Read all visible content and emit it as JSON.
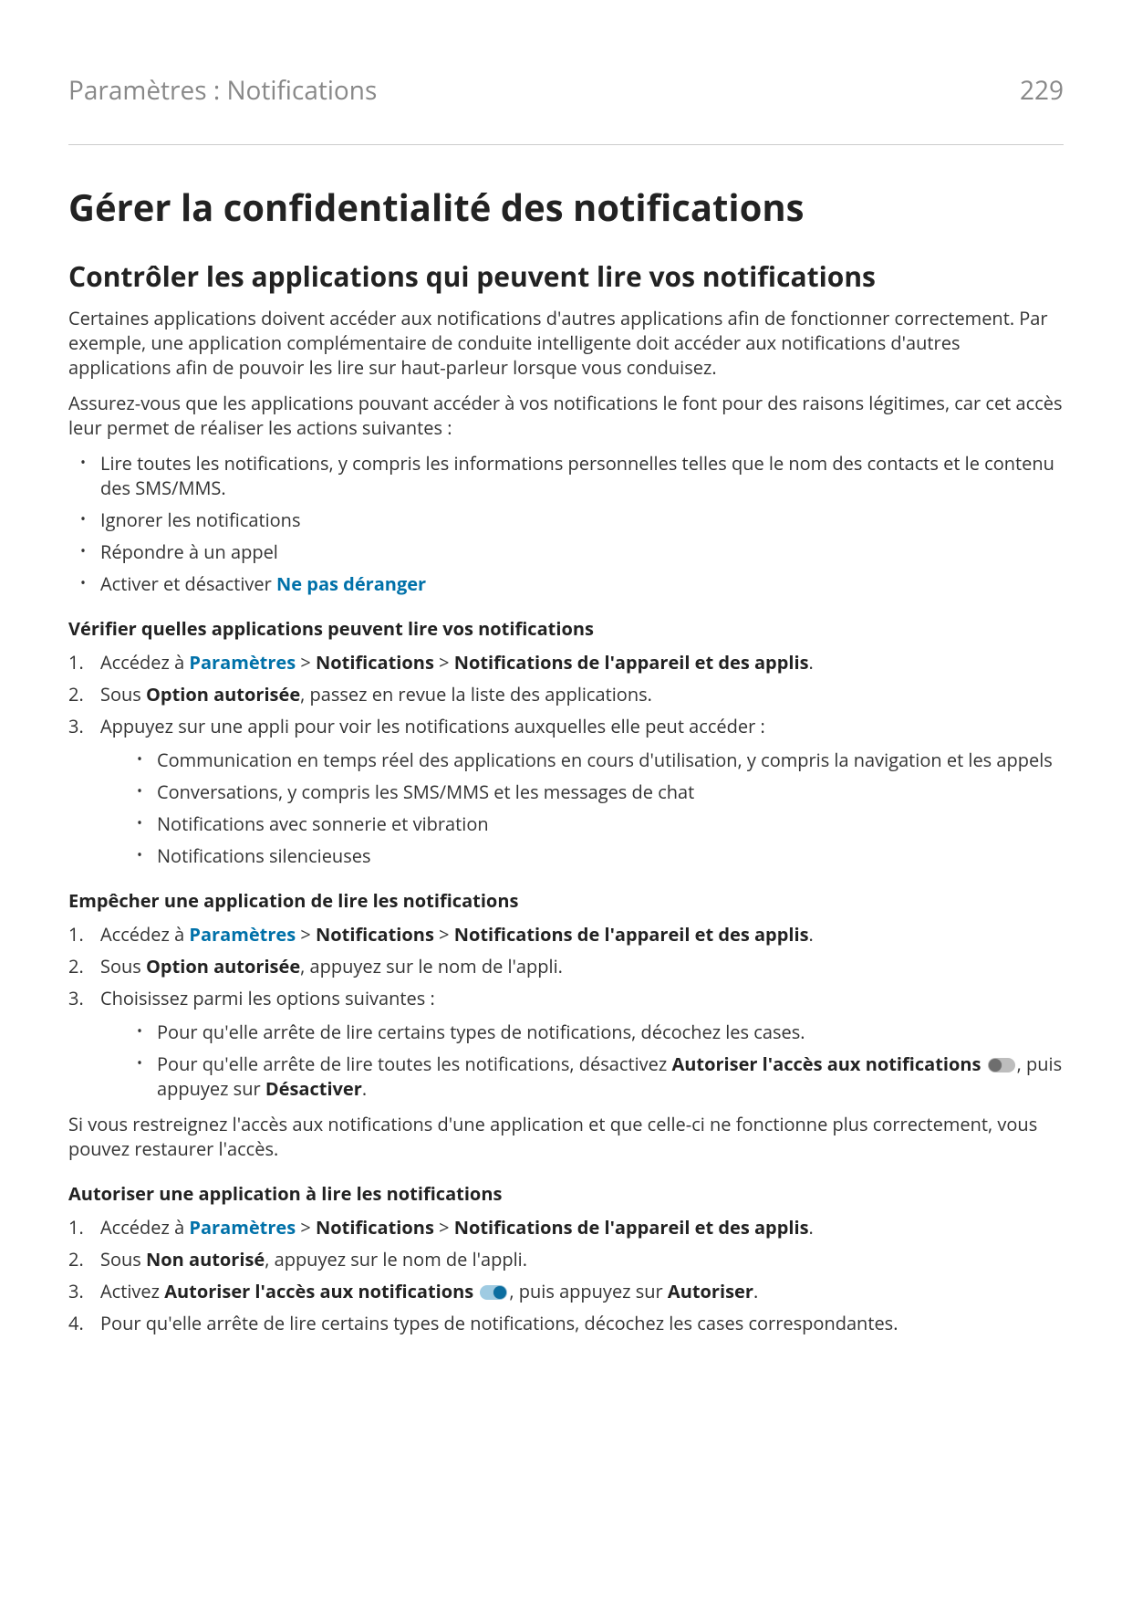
{
  "header": {
    "breadcrumb": "Paramètres : Notifications",
    "page_number": "229"
  },
  "title": "Gérer la confidentialité des notifications",
  "section1": {
    "heading": "Contrôler les applications qui peuvent lire vos notifications",
    "para1": "Certaines applications doivent accéder aux notifications d'autres applications afin de fonctionner correctement. Par exemple, une application complémentaire de conduite intelligente doit accéder aux notifications d'autres applications afin de pouvoir les lire sur haut-parleur lorsque vous conduisez.",
    "para2": "Assurez-vous que les applications pouvant accéder à vos notifications le font pour des raisons légitimes, car cet accès leur permet de réaliser les actions suivantes :",
    "bullets": {
      "b1": "Lire toutes les notifications, y compris les informations personnelles telles que le nom des contacts et le contenu des SMS/MMS.",
      "b2": "Ignorer les notifications",
      "b3": "Répondre à un appel",
      "b4_prefix": "Activer et désactiver ",
      "b4_link": "Ne pas déranger"
    },
    "sub1_heading": "Vérifier quelles applications peuvent lire vos notifications",
    "nav": {
      "prefix": "Accédez à ",
      "settings": "Paramètres",
      "sep": " > ",
      "notifications": "Notifications",
      "device_app": "Notifications de l'appareil et des applis",
      "period": "."
    },
    "sub1_step2_prefix": "Sous ",
    "sub1_step2_bold": "Option autorisée",
    "sub1_step2_suffix": ", passez en revue la liste des applications.",
    "sub1_step3": "Appuyez sur une appli pour voir les notifications auxquelles elle peut accéder :",
    "sub1_sub_bullets": {
      "a": "Communication en temps réel des applications en cours d'utilisation, y compris la navigation et les appels",
      "b": "Conversations, y compris les SMS/MMS et les messages de chat",
      "c": "Notifications avec sonnerie et vibration",
      "d": "Notifications silencieuses"
    },
    "sub2_heading": "Empêcher une application de lire les notifications",
    "sub2_step2_prefix": "Sous ",
    "sub2_step2_bold": "Option autorisée",
    "sub2_step2_suffix": ", appuyez sur le nom de l'appli.",
    "sub2_step3": "Choisissez parmi les options suivantes :",
    "sub2_sub_bullets": {
      "a": "Pour qu'elle arrête de lire certains types de notifications, décochez les cases.",
      "b_prefix": "Pour qu'elle arrête de lire toutes les notifications, désactivez ",
      "b_bold1": "Autoriser l'accès aux notifications",
      "b_mid": ", puis appuyez sur ",
      "b_bold2": "Désactiver",
      "b_suffix": "."
    },
    "para3": "Si vous restreignez l'accès aux notifications d'une application et que celle-ci ne fonctionne plus correctement, vous pouvez restaurer l'accès.",
    "sub3_heading": "Autoriser une application à lire les notifications",
    "sub3_step2_prefix": "Sous ",
    "sub3_step2_bold": "Non autorisé",
    "sub3_step2_suffix": ", appuyez sur le nom de l'appli.",
    "sub3_step3_prefix": "Activez ",
    "sub3_step3_bold1": "Autoriser l'accès aux notifications",
    "sub3_step3_mid": ", puis appuyez sur ",
    "sub3_step3_bold2": "Autoriser",
    "sub3_step3_suffix": ".",
    "sub3_step4": "Pour qu'elle arrête de lire certains types de notifications, décochez les cases correspondantes."
  }
}
